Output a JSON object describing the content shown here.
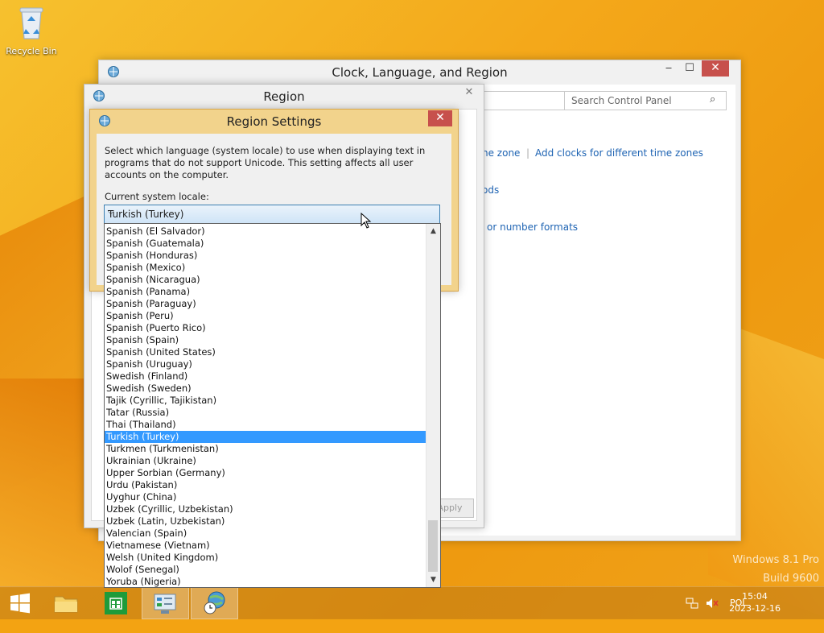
{
  "desktop": {
    "recycle_bin_label": "Recycle Bin",
    "watermark_line1": "Windows 8.1 Pro",
    "watermark_line2": "Build 9600"
  },
  "control_panel": {
    "title": "Clock, Language, and Region",
    "search_placeholder": "Search Control Panel",
    "link_time_zone": "ne zone",
    "link_add_clocks": "Add clocks for different time zones",
    "link_methods": "ods",
    "link_number_formats": "or number formats"
  },
  "region_window": {
    "title": "Region",
    "apply_label": "Apply"
  },
  "region_settings": {
    "title": "Region Settings",
    "description": "Select which language (system locale) to use when displaying text in programs that do not support Unicode. This setting affects all user accounts on the computer.",
    "current_locale_label": "Current system locale:",
    "selected_value": "Turkish (Turkey)",
    "options": [
      "Spanish (El Salvador)",
      "Spanish (Guatemala)",
      "Spanish (Honduras)",
      "Spanish (Mexico)",
      "Spanish (Nicaragua)",
      "Spanish (Panama)",
      "Spanish (Paraguay)",
      "Spanish (Peru)",
      "Spanish (Puerto Rico)",
      "Spanish (Spain)",
      "Spanish (United States)",
      "Spanish (Uruguay)",
      "Swedish (Finland)",
      "Swedish (Sweden)",
      "Tajik (Cyrillic, Tajikistan)",
      "Tatar (Russia)",
      "Thai (Thailand)",
      "Turkish (Turkey)",
      "Turkmen (Turkmenistan)",
      "Ukrainian (Ukraine)",
      "Upper Sorbian (Germany)",
      "Urdu (Pakistan)",
      "Uyghur (China)",
      "Uzbek (Cyrillic, Uzbekistan)",
      "Uzbek (Latin, Uzbekistan)",
      "Valencian (Spain)",
      "Vietnamese (Vietnam)",
      "Welsh (United Kingdom)",
      "Wolof (Senegal)",
      "Yoruba (Nigeria)"
    ]
  },
  "taskbar": {
    "language": "POL",
    "time": "15:04",
    "date": "2023-12-16"
  },
  "colors": {
    "accent_selected": "#3399ff",
    "close_button": "#c7504c",
    "dialog_frame": "#f2d38c",
    "link": "#1f64b3"
  }
}
